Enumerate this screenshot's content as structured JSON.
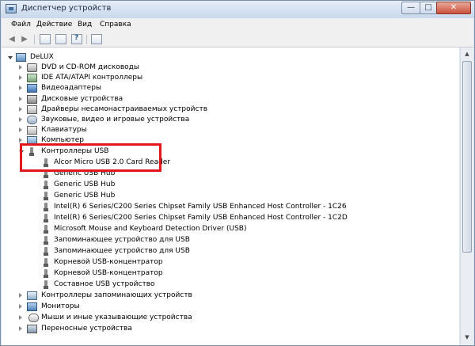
{
  "window": {
    "title": "Диспетчер устройств",
    "controls": {
      "minimize": "—",
      "maximize": "□",
      "close": "✕"
    }
  },
  "menu": [
    "Файл",
    "Действие",
    "Вид",
    "Справка"
  ],
  "toolbar": {
    "back": "◀",
    "forward": "▶"
  },
  "tree": {
    "root": "DeLUX",
    "categories": [
      "DVD и CD-ROM дисководы",
      "IDE ATA/ATAPI контроллеры",
      "Видеоадаптеры",
      "Дисковые устройства",
      "Драйверы несамонастраиваемых устройств",
      "Звуковые, видео и игровые устройства",
      "Клавиатуры",
      "Компьютер"
    ],
    "usb": {
      "label": "Контроллеры USB",
      "children": [
        "Alcor Micro USB 2.0 Card Reader",
        "Generic USB Hub",
        "Generic USB Hub",
        "Generic USB Hub",
        "Intel(R) 6 Series/C200 Series Chipset Family USB Enhanced Host Controller - 1C26",
        "Intel(R) 6 Series/C200 Series Chipset Family USB Enhanced Host Controller - 1C2D",
        "Microsoft Mouse and Keyboard Detection Driver (USB)",
        "Запоминающее устройство для USB",
        "Запоминающее устройство для USB",
        "Корневой USB-концентратор",
        "Корневой USB-концентратор",
        "Составное USB устройство"
      ]
    },
    "after": [
      "Контроллеры запоминающих устройств",
      "Мониторы",
      "Мыши и иные указывающие устройства",
      "Переносные устройства"
    ]
  },
  "scrollbar": {
    "up": "▲",
    "down": "▼"
  },
  "colors": {
    "highlight": "#e2161d",
    "title_bg": "#c9d8ec"
  }
}
